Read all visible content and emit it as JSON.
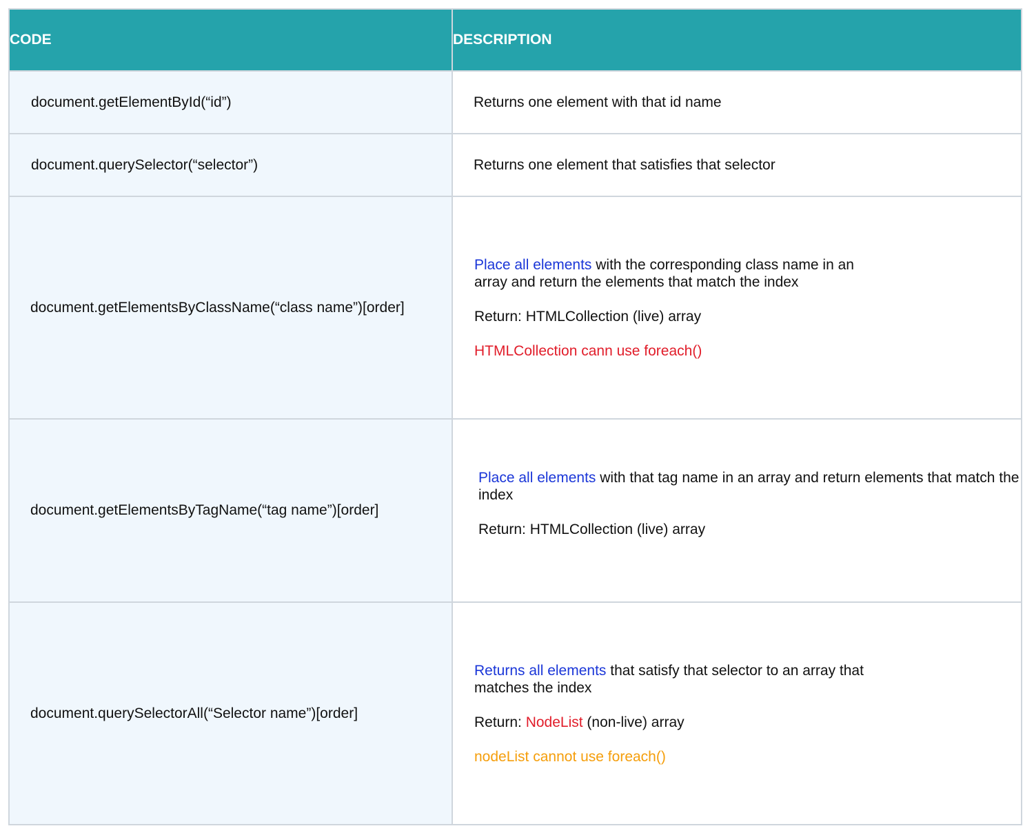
{
  "header": {
    "code": "CODE",
    "description": "DESCRIPTION"
  },
  "colors": {
    "header_bg": "#25a3ab",
    "code_bg": "#f0f7fd",
    "blue": "#1a36d8",
    "red": "#e11d2a",
    "orange": "#f59e0b",
    "border": "#cfd6dd"
  },
  "rows": [
    {
      "code": "document.getElementById(“id”)",
      "description": "Returns one element with that id name"
    },
    {
      "code": "document.querySelector(“selector”)",
      "description": "Returns one element that satisfies that selector"
    },
    {
      "code": "document.getElementsByClassName(“class name”)[order]",
      "desc_highlight": "Place all elements",
      "desc_rest": " with the corresponding class name in an array and return the elements that match the index",
      "return_line": "Return: HTMLCollection (live) array",
      "note": "HTMLCollection cann use foreach()"
    },
    {
      "code": "document.getElementsByTagName(“tag name”)[order]",
      "desc_highlight": "Place all elements",
      "desc_rest": " with that tag name in an array and return elements that match the index",
      "return_line": "Return: HTMLCollection (live) array"
    },
    {
      "code": "document.querySelectorAll(“Selector name”)[order]",
      "desc_highlight": "Returns all elements",
      "desc_rest": " that satisfy that selector to an array that matches the index",
      "return_prefix": "Return: ",
      "return_highlight": "NodeList",
      "return_suffix": " (non-live) array",
      "note": "nodeList cannot use foreach()"
    }
  ]
}
